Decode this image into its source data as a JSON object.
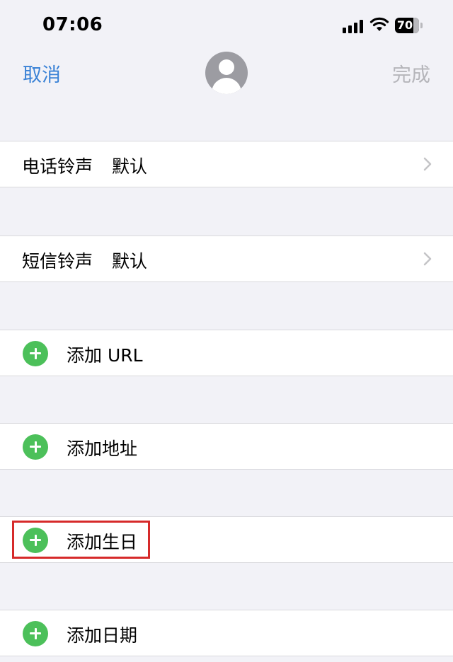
{
  "status_bar": {
    "time": "07:06",
    "battery": "70",
    "signal_icon": "signal-bars-icon",
    "wifi_icon": "wifi-icon"
  },
  "nav": {
    "cancel": "取消",
    "done": "完成",
    "avatar_icon": "person-avatar-icon"
  },
  "rows": {
    "ringtone": {
      "label": "电话铃声",
      "value": "默认"
    },
    "text_tone": {
      "label": "短信铃声",
      "value": "默认"
    },
    "add_url": "添加 URL",
    "add_address": "添加地址",
    "add_birthday": "添加生日",
    "add_date": "添加日期"
  },
  "colors": {
    "accent": "#3a82d6",
    "add_green": "#4cc05a",
    "highlight_red": "#d62a2a",
    "background": "#f2f2f7"
  }
}
